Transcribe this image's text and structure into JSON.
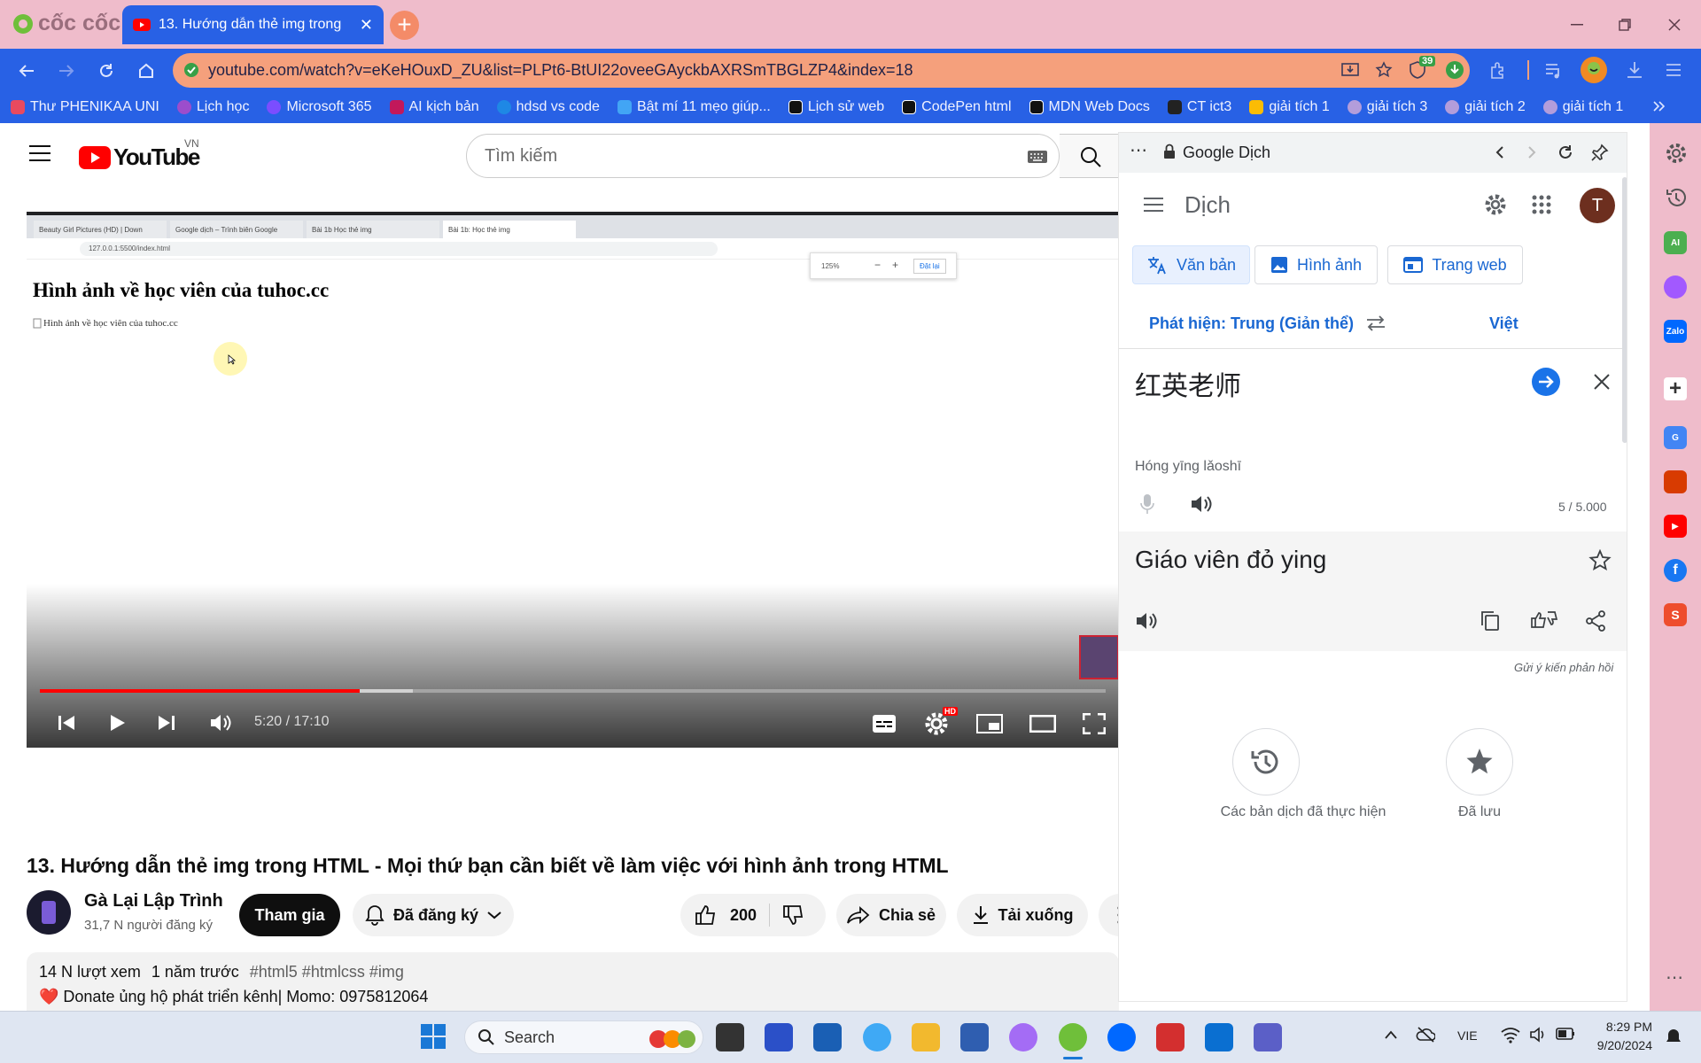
{
  "browser": {
    "brand": "cốc cốc",
    "tab_title": "13. Hướng dẫn thẻ img trong",
    "url": "youtube.com/watch?v=eKeHOuxD_ZU&list=PLPt6-BtUI22oveeGAyckbAXRSmTBGLZP4&index=18",
    "extension_badge": "39",
    "bookmarks": [
      {
        "label": "Thư PHENIKAA UNI",
        "color": "#e84a5f"
      },
      {
        "label": "Lịch học",
        "color": "#9c4dcc"
      },
      {
        "label": "Microsoft 365",
        "color": "#7b4dff"
      },
      {
        "label": "AI kịch bản",
        "color": "#c2185b"
      },
      {
        "label": "hdsd vs code",
        "color": "#1e88e5"
      },
      {
        "label": "Bật mí 11 mẹo giúp...",
        "color": "#42a5f5"
      },
      {
        "label": "Lịch sử web",
        "color": "#111111"
      },
      {
        "label": "CodePen html",
        "color": "#111111"
      },
      {
        "label": "MDN Web Docs",
        "color": "#111111"
      },
      {
        "label": "CT ict3",
        "color": "#222222"
      },
      {
        "label": "giải tích 1",
        "color": "#fbbc04"
      },
      {
        "label": "giải tích 3",
        "color": "#b39ddb"
      },
      {
        "label": "giải tích 2",
        "color": "#b39ddb"
      },
      {
        "label": "giải tích 1",
        "color": "#b39ddb"
      }
    ]
  },
  "youtube": {
    "logo": "YouTube",
    "region": "VN",
    "search_placeholder": "Tìm kiếm",
    "player": {
      "inner_tabs": [
        "Beauty Girl Pictures (HD) | Down",
        "Google dịch – Trình biên Google",
        "Bài 1b Học thẻ img",
        "Bài 1b: Học thẻ img"
      ],
      "inner_url": "127.0.0.1:5500/index.html",
      "zoom_text": "125%",
      "zoom_reset": "Đặt lại",
      "heading": "Hình ảnh về học viên của tuhoc.cc",
      "broken_img_alt": "Hình ảnh về học viên của tuhoc.cc",
      "time": "5:20 / 17:10",
      "progress": 0.3,
      "buffered": 0.35,
      "hd_badge": "HD"
    },
    "video_title": "13. Hướng dẫn thẻ img trong HTML - Mọi thứ bạn cần biết về làm việc với hình ảnh trong HTML",
    "channel_name": "Gà Lại Lập Trình",
    "subscribers": "31,7 N người đăng ký",
    "join_label": "Tham gia",
    "subscribed_label": "Đã đăng ký",
    "likes": "200",
    "share_label": "Chia sẻ",
    "download_label": "Tải xuống",
    "views": "14 N lượt xem",
    "age": "1 năm trước",
    "hashtags": "#html5 #htmlcss #img",
    "donate": "❤️ Donate ủng hộ phát triển kênh| Momo: 0975812064"
  },
  "translate": {
    "panel_title": "Google Dịch",
    "app_title": "Dịch",
    "avatar": "T",
    "tabs": [
      "Văn bản",
      "Hình ảnh",
      "Trang web"
    ],
    "source_lang": "Phát hiện: Trung (Giản thể)",
    "target_lang": "Việt",
    "source_text": "红英老师",
    "romanization": "Hóng yīng lǎoshī",
    "char_count": "5 / 5.000",
    "result": "Giáo viên đỏ ying",
    "feedback": "Gửi ý kiến phản hồi",
    "history_label": "Các bản dịch đã thực hiện",
    "saved_label": "Đã lưu"
  },
  "sidebar_icons": [
    {
      "name": "ai-app-icon",
      "label": "AI",
      "color": "#4caf50"
    },
    {
      "name": "messenger-icon",
      "label": "",
      "color": "#a259ff"
    },
    {
      "name": "zalo-icon",
      "label": "Zalo",
      "color": "#0068ff"
    },
    {
      "name": "google-translate-icon",
      "label": "G",
      "color": "#4285f4"
    },
    {
      "name": "office-icon",
      "label": "",
      "color": "#d83b01"
    },
    {
      "name": "youtube-icon",
      "label": "▶",
      "color": "#ff0000"
    },
    {
      "name": "facebook-icon",
      "label": "f",
      "color": "#1877f2"
    },
    {
      "name": "shopee-icon",
      "label": "S",
      "color": "#ee4d2d"
    }
  ],
  "taskbar": {
    "search": "Search",
    "lang": "VIE",
    "time": "8:29 PM",
    "date": "9/20/2024"
  },
  "colors": {
    "tabbar": "#efbccb",
    "toolbar": "#2861e5",
    "urlbar": "#f5a07c",
    "youtube_red": "#ff0000",
    "translate_blue": "#1a73e8"
  }
}
